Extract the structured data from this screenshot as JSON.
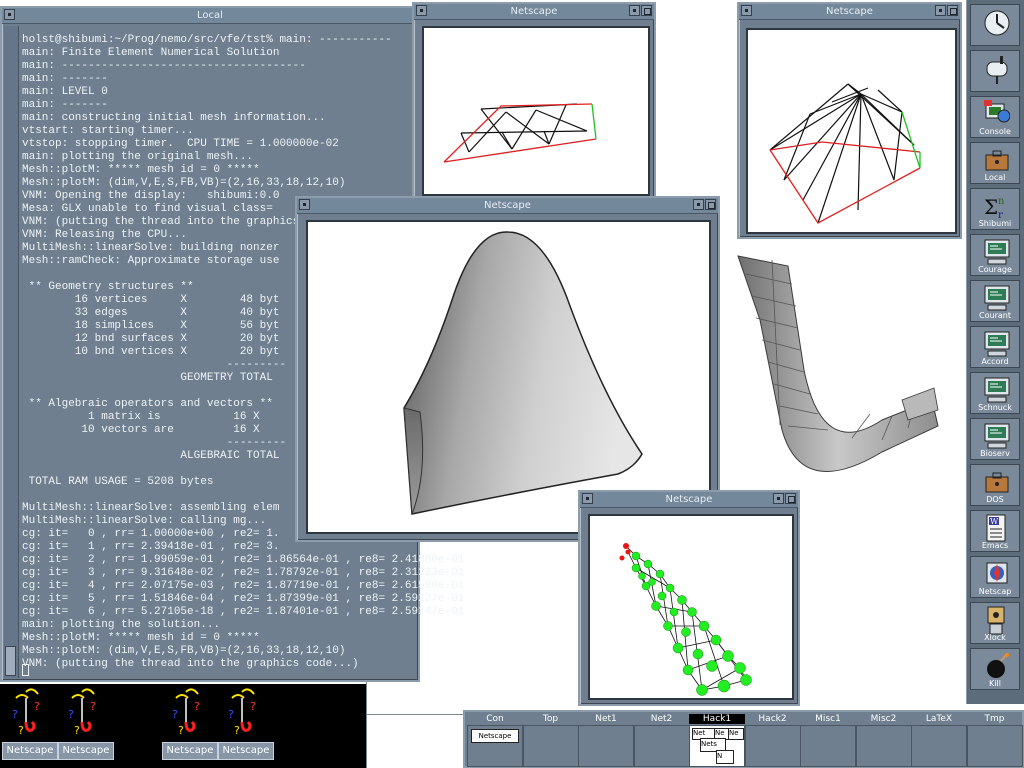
{
  "terminal": {
    "title": "Local",
    "lines": [
      "holst@shibumi:~/Prog/nemo/src/vfe/tst% main: -----------",
      "main: Finite Element Numerical Solution",
      "main: -------------------------------------",
      "main: -------",
      "main: LEVEL 0",
      "main: -------",
      "main: constructing initial mesh information...",
      "vtstart: starting timer...",
      "vtstop: stopping timer.  CPU TIME = 1.000000e-02",
      "main: plotting the original mesh...",
      "Mesh::plotM: ***** mesh id = 0 *****",
      "Mesh::plotM: (dim,V,E,S,FB,VB)=(2,16,33,18,12,10)",
      "VNM: Opening the display:   shibumi:0.0",
      "Mesa: GLX unable to find visual class=",
      "VNM: (putting the thread into the graphics",
      "VNM: Releasing the CPU...",
      "MultiMesh::linearSolve: building nonzer",
      "Mesh::ramCheck: Approximate storage use",
      "",
      " ** Geometry structures **",
      "        16 vertices     X        48 byt",
      "        33 edges        X        40 byt",
      "        18 simplices    X        56 byt",
      "        12 bnd surfaces X        20 byt",
      "        10 bnd vertices X        20 byt",
      "                               ---------",
      "                        GEOMETRY TOTAL",
      "",
      " ** Algebraic operators and vectors **",
      "          1 matrix is           16 X",
      "         10 vectors are         16 X",
      "                               ---------",
      "                        ALGEBRAIC TOTAL",
      "",
      " TOTAL RAM USAGE = 5208 bytes",
      "",
      "MultiMesh::linearSolve: assembling elem",
      "MultiMesh::linearSolve: calling mg...",
      "cg: it=   0 , rr= 1.00000e+00 , re2= 1.",
      "cg: it=   1 , rr= 2.39418e-01 , re2= 3.",
      "cg: it=   2 , rr= 1.99059e-01 , re2= 1.86564e-01 , re8= 2.41880e-01",
      "cg: it=   3 , rr= 9.31648e-02 , re2= 1.78792e-01 , re8= 2.31223e-01",
      "cg: it=   4 , rr= 2.07175e-03 , re2= 1.87719e-01 , re8= 2.61500e-01",
      "cg: it=   5 , rr= 1.51846e-04 , re2= 1.87399e-01 , re8= 2.59227e-01",
      "cg: it=   6 , rr= 5.27105e-18 , re2= 1.87401e-01 , re8= 2.59247e-01",
      "main: plotting the solution...",
      "Mesh::plotM: ***** mesh id = 0 *****",
      "Mesh::plotM: (dim,V,E,S,FB,VB)=(2,16,33,18,12,10)",
      "VNM: (putting the thread into the graphics code...)"
    ]
  },
  "netscape_windows": {
    "mesh2d": {
      "title": "Netscape"
    },
    "mesh3d": {
      "title": "Netscape"
    },
    "surface": {
      "title": "Netscape"
    },
    "dots": {
      "title": "Netscape"
    }
  },
  "dock": [
    {
      "label": "",
      "icon": "clock-icon"
    },
    {
      "label": "",
      "icon": "mailbox-icon"
    },
    {
      "label": "Console",
      "icon": "console-icon"
    },
    {
      "label": "Local",
      "icon": "briefcase-icon"
    },
    {
      "label": "Shibumi",
      "icon": "sigma-icon"
    },
    {
      "label": "Courage",
      "icon": "computer-icon"
    },
    {
      "label": "Courant",
      "icon": "computer-icon"
    },
    {
      "label": "Accord",
      "icon": "computer-icon"
    },
    {
      "label": "Schnuck",
      "icon": "computer-icon"
    },
    {
      "label": "Bioserv",
      "icon": "computer-icon"
    },
    {
      "label": "DOS",
      "icon": "briefcase-icon"
    },
    {
      "label": "Emacs",
      "icon": "emacs-icon"
    },
    {
      "label": "Netscap",
      "icon": "netscape-icon"
    },
    {
      "label": "Xlock",
      "icon": "lock-icon"
    },
    {
      "label": "Kill",
      "icon": "bomb-icon"
    }
  ],
  "iconified": [
    {
      "label": "Netscape"
    },
    {
      "label": "Netscape"
    },
    {
      "label": "Netscape"
    },
    {
      "label": "Netscape"
    }
  ],
  "pager": {
    "desks": [
      "Con",
      "Top",
      "Net1",
      "Net2",
      "Hack1",
      "Hack2",
      "Misc1",
      "Misc2",
      "LaTeX",
      "Tmp"
    ],
    "active": "Hack1",
    "con_window_label": "Netscape",
    "mini_labels": [
      "Net",
      "Ne",
      "Ne",
      "Nets",
      "N"
    ]
  },
  "colors": {
    "window_frame": "#6f7f8f",
    "terminal_text": "#eef3f6",
    "mesh_boundary_red": "#e02020",
    "mesh_boundary_green": "#20c020",
    "node_green": "#22ee22",
    "node_red": "#ee1111"
  }
}
